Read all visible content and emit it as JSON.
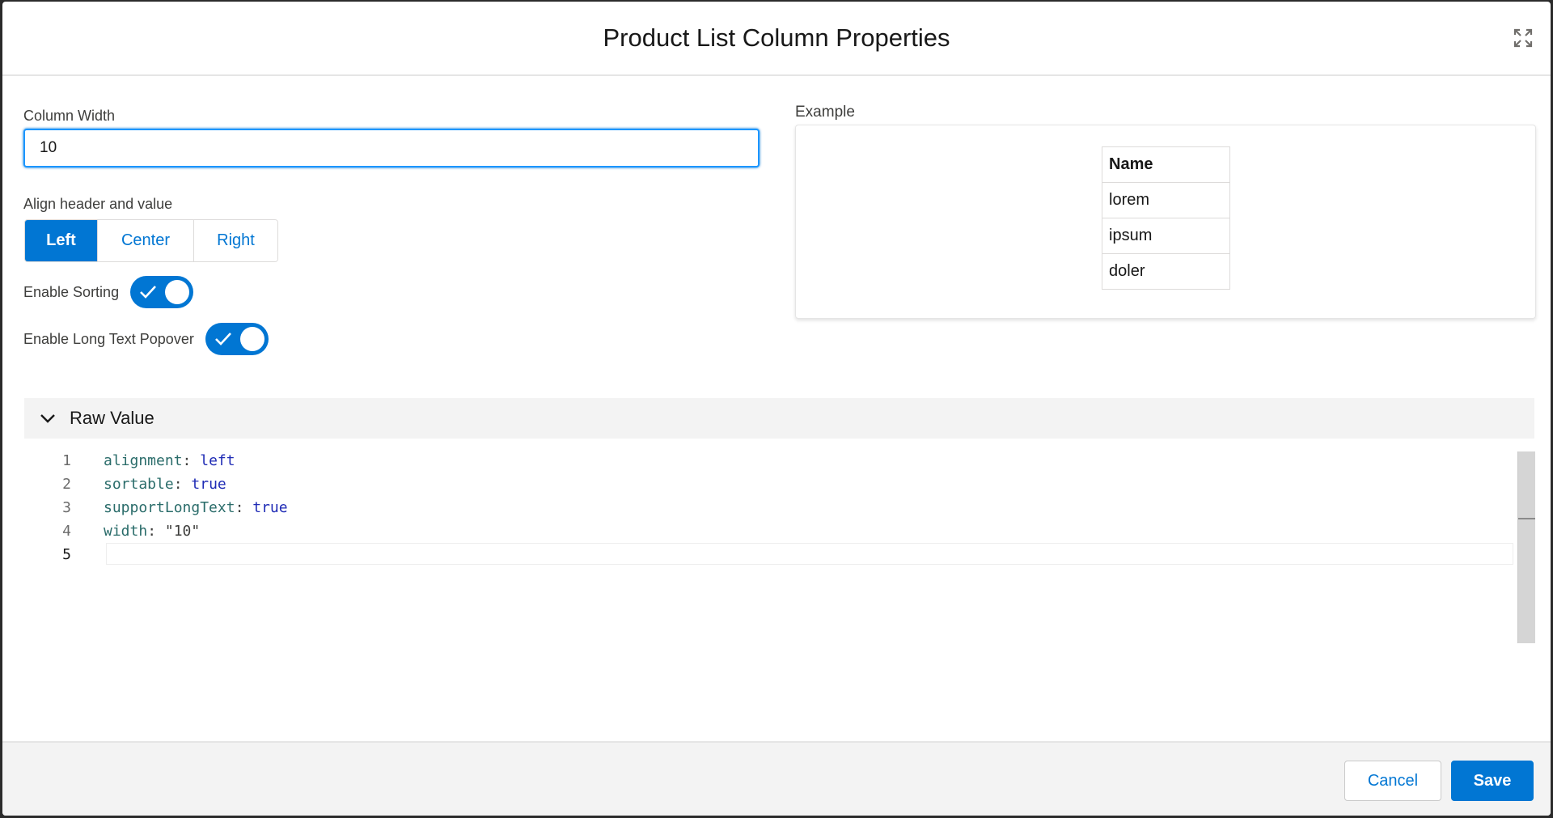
{
  "modal": {
    "title": "Product List Column Properties",
    "expand_icon": "expand-icon"
  },
  "column_width": {
    "label": "Column Width",
    "value": "10"
  },
  "align": {
    "label": "Align header and value",
    "options": [
      "Left",
      "Center",
      "Right"
    ],
    "selected": "Left"
  },
  "sorting": {
    "label": "Enable Sorting",
    "enabled": true
  },
  "long_text": {
    "label": "Enable Long Text Popover",
    "enabled": true
  },
  "example": {
    "label": "Example",
    "table_header": "Name",
    "rows": [
      "lorem",
      "ipsum",
      "doler"
    ]
  },
  "raw_value": {
    "title": "Raw Value",
    "lines": [
      {
        "num": "1",
        "key": "alignment",
        "value": "left"
      },
      {
        "num": "2",
        "key": "sortable",
        "value": "true"
      },
      {
        "num": "3",
        "key": "supportLongText",
        "value": "true"
      },
      {
        "num": "4",
        "key": "width",
        "value": "\"10\""
      },
      {
        "num": "5",
        "key": "",
        "value": ""
      }
    ]
  },
  "footer": {
    "cancel_label": "Cancel",
    "save_label": "Save"
  },
  "colors": {
    "brand": "#0176d3",
    "code_key": "#2a6c6a",
    "code_value": "#1f2bb5"
  }
}
